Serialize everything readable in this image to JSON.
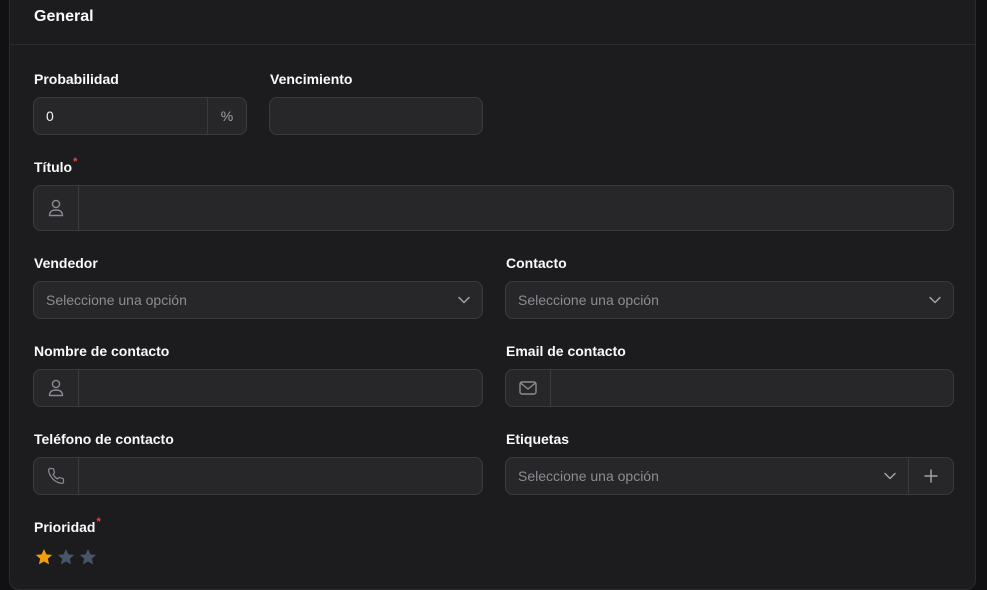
{
  "section": {
    "title": "General"
  },
  "probabilidad": {
    "label": "Probabilidad",
    "value": "0",
    "suffix": "%"
  },
  "vencimiento": {
    "label": "Vencimiento",
    "value": ""
  },
  "titulo": {
    "label": "Título",
    "required_mark": "*",
    "value": ""
  },
  "vendedor": {
    "label": "Vendedor",
    "placeholder": "Seleccione una opción"
  },
  "contacto": {
    "label": "Contacto",
    "placeholder": "Seleccione una opción"
  },
  "nombre_contacto": {
    "label": "Nombre de contacto",
    "value": ""
  },
  "email_contacto": {
    "label": "Email de contacto",
    "value": ""
  },
  "telefono_contacto": {
    "label": "Teléfono de contacto",
    "value": ""
  },
  "etiquetas": {
    "label": "Etiquetas",
    "placeholder": "Seleccione una opción"
  },
  "prioridad": {
    "label": "Prioridad",
    "required_mark": "*",
    "rating": 1,
    "max": 3
  },
  "colors": {
    "star_active": "#f59e0b",
    "star_inactive": "#475569",
    "required": "#ef4444"
  }
}
